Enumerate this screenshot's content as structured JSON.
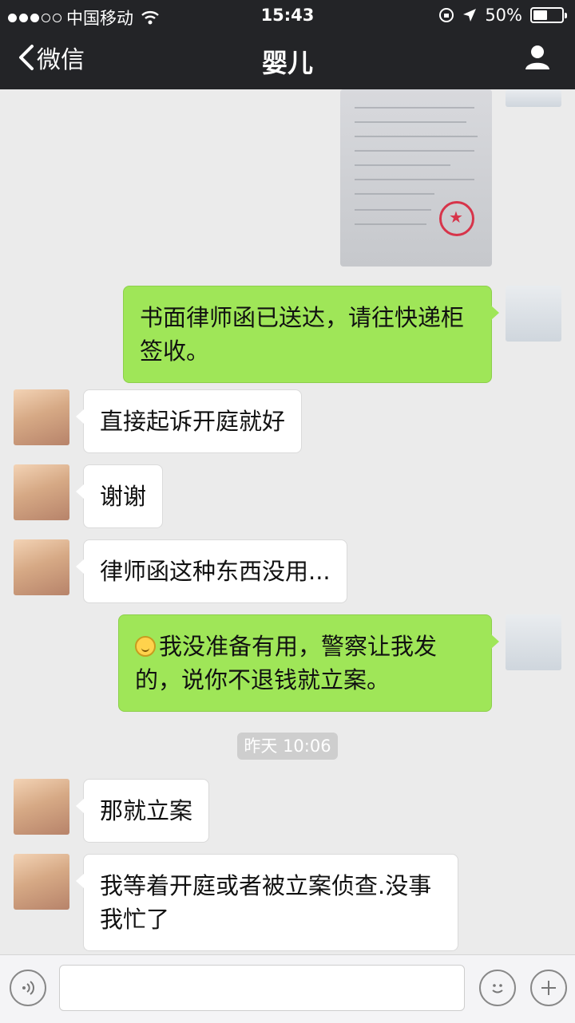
{
  "status_bar": {
    "carrier": "中国移动",
    "time": "15:43",
    "battery": "50%",
    "battery_level": 0.5
  },
  "nav": {
    "back_label": "微信",
    "title": "婴儿"
  },
  "messages": [
    {
      "sender": "me",
      "type": "image",
      "content": "document photo"
    },
    {
      "sender": "me",
      "text": "书面律师函已送达，请往快递柜签收。"
    },
    {
      "sender": "contact",
      "text": "直接起诉开庭就好"
    },
    {
      "sender": "contact",
      "text": "谢谢"
    },
    {
      "sender": "contact",
      "text": "律师函这种东西没用..."
    },
    {
      "sender": "me",
      "emoji": "smile-icon",
      "text": "我没准备有用，警察让我发的，说你不退钱就立案。"
    },
    {
      "sender": "contact",
      "text": "那就立案"
    },
    {
      "sender": "contact",
      "text": "我等着开庭或者被立案侦查.没事我忙了"
    }
  ],
  "timestamp": "昨天 10:06",
  "colors": {
    "nav_bg": "#232427",
    "chat_bg": "#ebebeb",
    "outgoing_bubble": "#9fe658",
    "incoming_bubble": "#ffffff"
  }
}
